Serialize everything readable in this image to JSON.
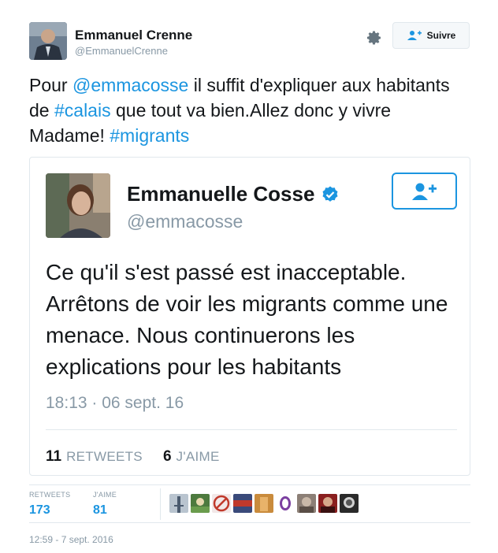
{
  "tweet": {
    "author_name": "Emmanuel Crenne",
    "author_handle": "@EmmanuelCrenne",
    "follow_label": "Suivre",
    "text_parts": {
      "p1": "Pour ",
      "mention": "@emmacosse",
      "p2": " il suffit d'expliquer aux habitants de ",
      "hashtag1": "#calais",
      "p3": " que tout va bien.Allez donc y vivre Madame! ",
      "hashtag2": "#migrants"
    },
    "timestamp": "12:59 - 7 sept. 2016",
    "stats": {
      "retweets_label": "RETWEETS",
      "retweets": "173",
      "likes_label": "J'AIME",
      "likes": "81"
    }
  },
  "quoted": {
    "author_name": "Emmanuelle Cosse",
    "author_handle": "@emmacosse",
    "verified": true,
    "text": "Ce qu'il s'est passé est inacceptable. Arrêtons de voir les migrants comme une menace. Nous continuerons les explications pour les habitants",
    "timestamp": "18:13 · 06 sept. 16",
    "retweets": "11",
    "retweets_label": "RETWEETS",
    "likes": "6",
    "likes_label": "J'AIME"
  },
  "colors": {
    "accent": "#1b95e0",
    "muted": "#8899a6",
    "border": "#e1e8ed"
  },
  "icons": {
    "settings": "gear-icon",
    "follow": "follow-person-plus-icon",
    "verified": "verified-badge-icon"
  }
}
